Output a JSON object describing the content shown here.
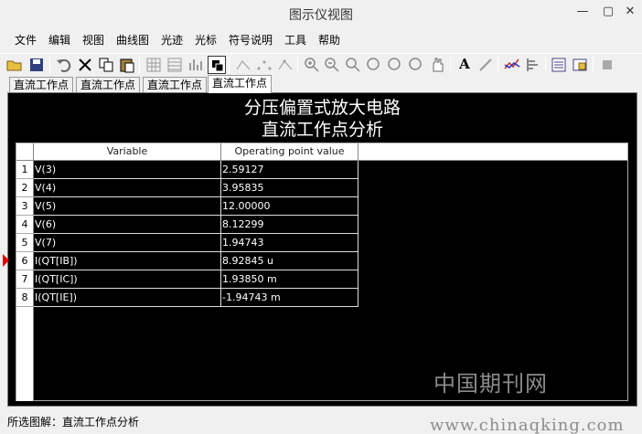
{
  "window": {
    "title": "图示仪视图",
    "minimize": "—",
    "maximize": "▢",
    "close": "✕"
  },
  "menu": [
    "文件",
    "编辑",
    "视图",
    "曲线图",
    "光迹",
    "光标",
    "符号说明",
    "工具",
    "帮助"
  ],
  "toolbar": {
    "icons": [
      "open-icon",
      "save-icon",
      "undo-icon",
      "delete-icon",
      "copy-icon",
      "paste-icon",
      "grid-icon",
      "table-icon",
      "bars-icon",
      "select-icon",
      "curve1-icon",
      "curve2-icon",
      "curve3-icon",
      "zoom-in-icon",
      "zoom-out-icon",
      "zoom-fit-icon",
      "zoom-x-icon",
      "zoom-y-icon",
      "zoom-all-icon",
      "pan-icon",
      "text-icon",
      "cursor-icon",
      "chart-icon",
      "export-icon",
      "print-icon",
      "settings-icon",
      "stop-icon"
    ]
  },
  "tabs": [
    "直流工作点",
    "直流工作点",
    "直流工作点",
    "直流工作点"
  ],
  "content": {
    "title_line1": "分压偏置式放大电路",
    "title_line2": "直流工作点分析",
    "columns": [
      "Variable",
      "Operating point value"
    ],
    "rows": [
      {
        "num": "1",
        "variable": "V(3)",
        "value": "2.59127"
      },
      {
        "num": "2",
        "variable": "V(4)",
        "value": "3.95835"
      },
      {
        "num": "3",
        "variable": "V(5)",
        "value": "12.00000"
      },
      {
        "num": "4",
        "variable": "V(6)",
        "value": "8.12299"
      },
      {
        "num": "5",
        "variable": "V(7)",
        "value": "1.94743"
      },
      {
        "num": "6",
        "variable": "I(QT[IB])",
        "value": "8.92845 u"
      },
      {
        "num": "7",
        "variable": "I(QT[IC])",
        "value": "1.93850 m"
      },
      {
        "num": "8",
        "variable": "I(QT[IE])",
        "value": "-1.94743 m"
      }
    ]
  },
  "status": "所选图解：直流工作点分析",
  "watermark": {
    "chinese": "中国期刊网",
    "url": "www.chinaqking.com"
  }
}
